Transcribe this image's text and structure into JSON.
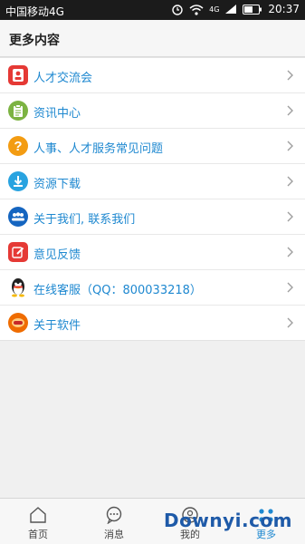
{
  "status_bar": {
    "carrier": "中国移动4G",
    "network": "4G",
    "time": "20:37"
  },
  "header": {
    "title": "更多内容"
  },
  "menu": [
    {
      "label": "人才交流会",
      "icon": "talent-fair-icon",
      "color": "#e53935"
    },
    {
      "label": "资讯中心",
      "icon": "news-clipboard-icon",
      "color": "#7cb342"
    },
    {
      "label": "人事、人才服务常见问题",
      "icon": "question-icon",
      "color": "#f39c12"
    },
    {
      "label": "资源下载",
      "icon": "download-icon",
      "color": "#29a3e0"
    },
    {
      "label": "关于我们, 联系我们",
      "icon": "about-us-icon",
      "color": "#1565c0"
    },
    {
      "label": "意见反馈",
      "icon": "feedback-edit-icon",
      "color": "#e53935"
    },
    {
      "label": "在线客服（QQ：800033218）",
      "icon": "qq-penguin-icon",
      "color": "#222222"
    },
    {
      "label": "关于软件",
      "icon": "about-software-icon",
      "color": "#ef6c00"
    }
  ],
  "tabs": [
    {
      "label": "首页",
      "icon": "home-icon",
      "active": false
    },
    {
      "label": "消息",
      "icon": "message-icon",
      "active": false
    },
    {
      "label": "我的",
      "icon": "profile-icon",
      "active": false
    },
    {
      "label": "更多",
      "icon": "more-icon",
      "active": true
    }
  ],
  "watermark": "Downyi.com",
  "colors": {
    "accent": "#1e88d0",
    "status_bar": "#1b1b1b"
  }
}
